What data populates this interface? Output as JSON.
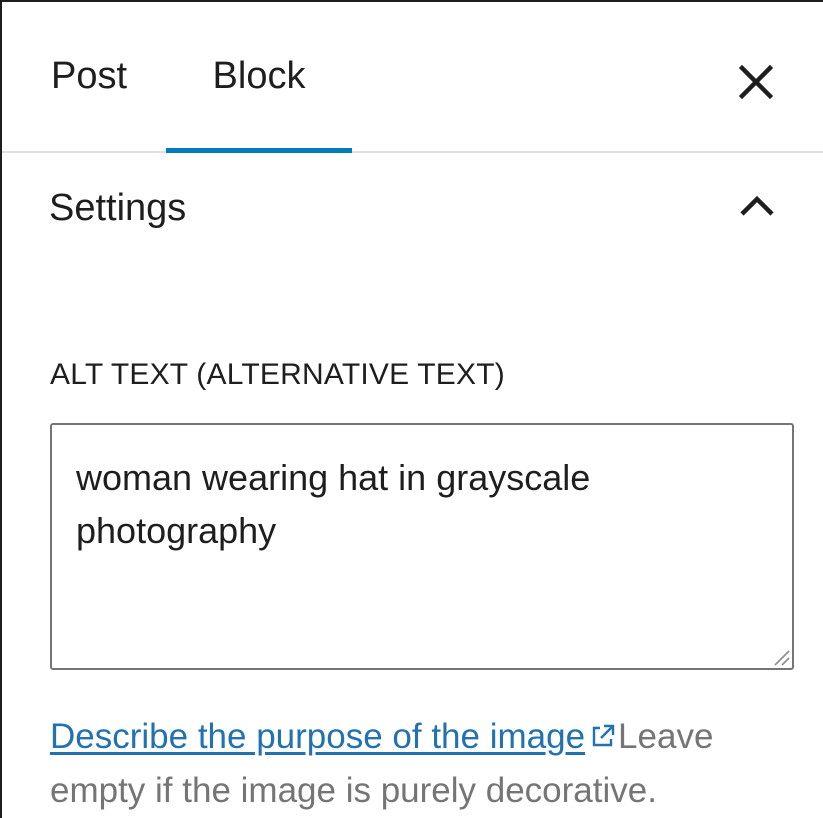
{
  "tabs": {
    "post_label": "Post",
    "block_label": "Block",
    "active": "Block"
  },
  "close_icon": "close-icon",
  "settings": {
    "title": "Settings",
    "toggle_icon": "chevron-up-icon",
    "expanded": true
  },
  "alt_text": {
    "label": "ALT TEXT (ALTERNATIVE TEXT)",
    "value": "woman wearing hat in grayscale photography"
  },
  "help": {
    "link_text": "Describe the purpose of the image",
    "link_icon": "external-link-icon",
    "text": "Leave empty if the image is purely decorative."
  },
  "colors": {
    "accent": "#007cba",
    "link": "#2271b1",
    "text": "#1e1e1e",
    "muted": "#757575"
  }
}
